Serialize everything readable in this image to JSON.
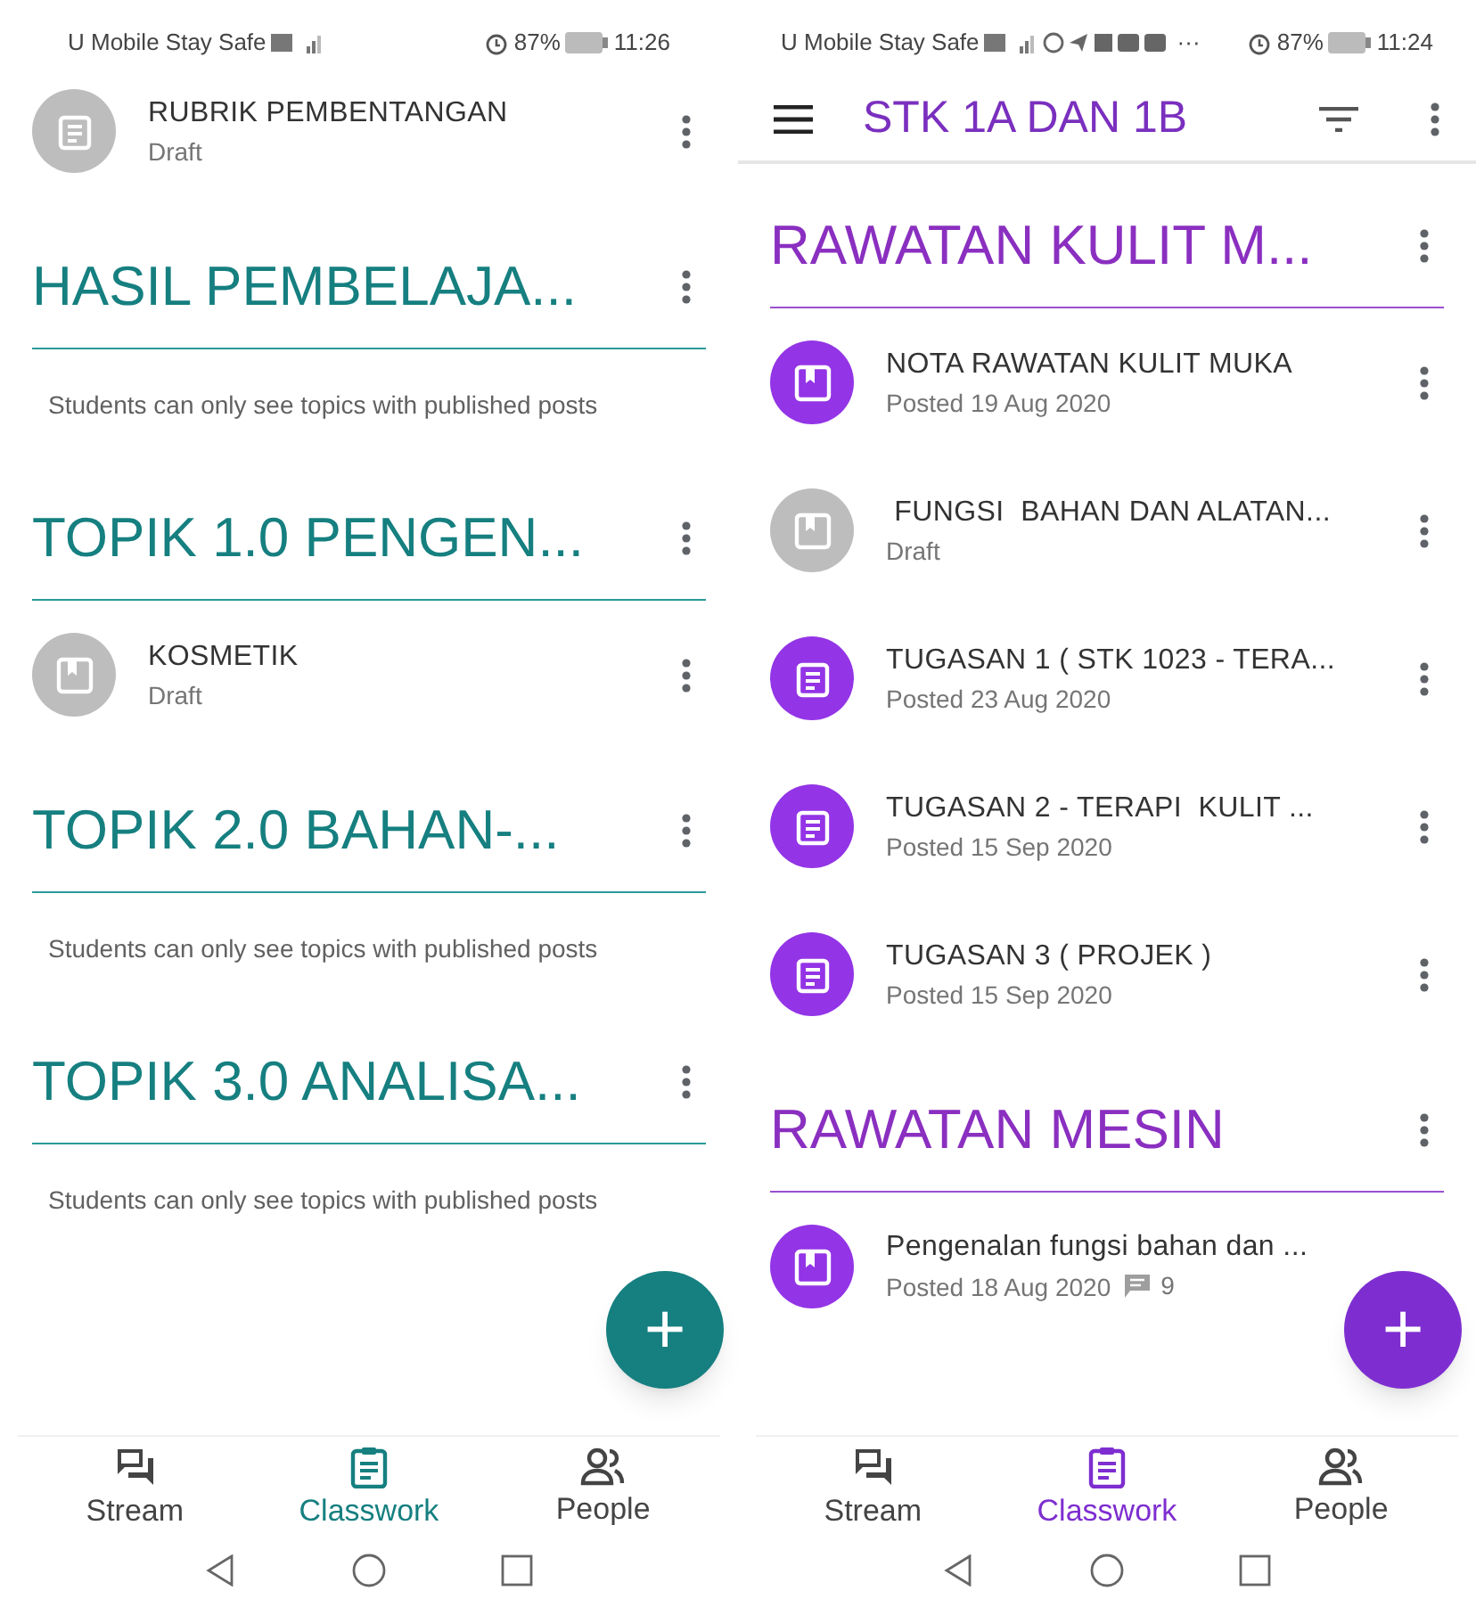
{
  "phones": [
    {
      "status": {
        "carrier": "U Mobile Stay Safe",
        "battery": "87%",
        "time": "11:26"
      },
      "sections": [
        {
          "kind": "item",
          "item": {
            "kind": "assignment",
            "title": "RUBRIK PEMBENTANGAN",
            "subtitle": "Draft",
            "draft": true,
            "more_menu": true
          }
        },
        {
          "kind": "topic",
          "title": "HASIL PEMBELAJA...",
          "note": "Students can only see topics with published posts"
        },
        {
          "kind": "topic",
          "title": "TOPIK 1.0 PENGEN...",
          "items": [
            {
              "kind": "material",
              "title": "KOSMETIK",
              "subtitle": "Draft",
              "draft": true,
              "more_menu": true
            }
          ]
        },
        {
          "kind": "topic",
          "title": "TOPIK 2.0 BAHAN-...",
          "note": "Students can only see topics with published posts"
        },
        {
          "kind": "topic",
          "title": "TOPIK 3.0 ANALISA...",
          "note": "Students can only see topics with published posts"
        }
      ],
      "fab": "+",
      "tabs": [
        {
          "label": "Stream",
          "selected": false
        },
        {
          "label": "Classwork",
          "selected": true
        },
        {
          "label": "People",
          "selected": false
        }
      ]
    },
    {
      "status": {
        "carrier": "U Mobile Stay Safe",
        "overflow": "···",
        "battery": "87%",
        "time": "11:24"
      },
      "app_bar": {
        "title": "STK 1A DAN 1B"
      },
      "sections": [
        {
          "kind": "topic",
          "title": "RAWATAN KULIT M...",
          "items": [
            {
              "kind": "material",
              "title": "NOTA RAWATAN KULIT MUKA",
              "subtitle": "Posted 19 Aug 2020",
              "draft": false,
              "more_menu": true
            },
            {
              "kind": "material",
              "title": " FUNGSI  BAHAN DAN ALATAN...",
              "subtitle": "Draft",
              "draft": true,
              "more_menu": true
            },
            {
              "kind": "assignment",
              "title": "TUGASAN 1 ( STK 1023 - TERA...",
              "subtitle": "Posted 23 Aug 2020",
              "draft": false,
              "more_menu": true
            },
            {
              "kind": "assignment",
              "title": "TUGASAN 2 - TERAPI  KULIT ...",
              "subtitle": "Posted 15 Sep 2020",
              "draft": false,
              "more_menu": true
            },
            {
              "kind": "assignment",
              "title": "TUGASAN 3 ( PROJEK )",
              "subtitle": "Posted 15 Sep 2020",
              "draft": false,
              "more_menu": true
            }
          ]
        },
        {
          "kind": "topic",
          "title": "RAWATAN MESIN",
          "items": [
            {
              "kind": "material",
              "title": "Pengenalan fungsi bahan dan ...",
              "subtitle": "Posted 18 Aug 2020",
              "comments": "9",
              "draft": false,
              "more_menu": false
            }
          ]
        }
      ],
      "fab": "+",
      "tabs": [
        {
          "label": "Stream",
          "selected": false
        },
        {
          "label": "Classwork",
          "selected": true
        },
        {
          "label": "People",
          "selected": false
        }
      ]
    }
  ]
}
